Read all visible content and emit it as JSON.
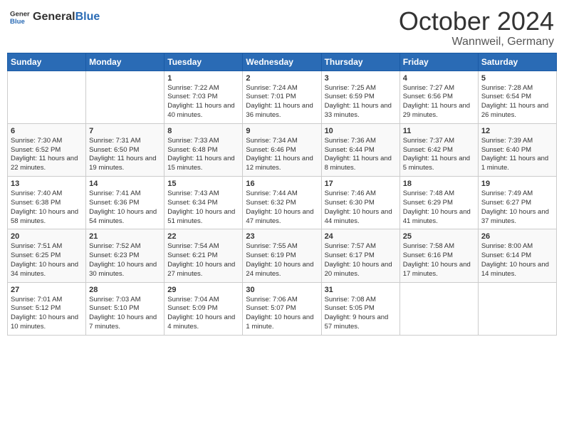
{
  "header": {
    "logo_general": "General",
    "logo_blue": "Blue",
    "month": "October 2024",
    "location": "Wannweil, Germany"
  },
  "weekdays": [
    "Sunday",
    "Monday",
    "Tuesday",
    "Wednesday",
    "Thursday",
    "Friday",
    "Saturday"
  ],
  "weeks": [
    [
      {
        "day": null,
        "sunrise": null,
        "sunset": null,
        "daylight": null
      },
      {
        "day": null,
        "sunrise": null,
        "sunset": null,
        "daylight": null
      },
      {
        "day": "1",
        "sunrise": "Sunrise: 7:22 AM",
        "sunset": "Sunset: 7:03 PM",
        "daylight": "Daylight: 11 hours and 40 minutes."
      },
      {
        "day": "2",
        "sunrise": "Sunrise: 7:24 AM",
        "sunset": "Sunset: 7:01 PM",
        "daylight": "Daylight: 11 hours and 36 minutes."
      },
      {
        "day": "3",
        "sunrise": "Sunrise: 7:25 AM",
        "sunset": "Sunset: 6:59 PM",
        "daylight": "Daylight: 11 hours and 33 minutes."
      },
      {
        "day": "4",
        "sunrise": "Sunrise: 7:27 AM",
        "sunset": "Sunset: 6:56 PM",
        "daylight": "Daylight: 11 hours and 29 minutes."
      },
      {
        "day": "5",
        "sunrise": "Sunrise: 7:28 AM",
        "sunset": "Sunset: 6:54 PM",
        "daylight": "Daylight: 11 hours and 26 minutes."
      }
    ],
    [
      {
        "day": "6",
        "sunrise": "Sunrise: 7:30 AM",
        "sunset": "Sunset: 6:52 PM",
        "daylight": "Daylight: 11 hours and 22 minutes."
      },
      {
        "day": "7",
        "sunrise": "Sunrise: 7:31 AM",
        "sunset": "Sunset: 6:50 PM",
        "daylight": "Daylight: 11 hours and 19 minutes."
      },
      {
        "day": "8",
        "sunrise": "Sunrise: 7:33 AM",
        "sunset": "Sunset: 6:48 PM",
        "daylight": "Daylight: 11 hours and 15 minutes."
      },
      {
        "day": "9",
        "sunrise": "Sunrise: 7:34 AM",
        "sunset": "Sunset: 6:46 PM",
        "daylight": "Daylight: 11 hours and 12 minutes."
      },
      {
        "day": "10",
        "sunrise": "Sunrise: 7:36 AM",
        "sunset": "Sunset: 6:44 PM",
        "daylight": "Daylight: 11 hours and 8 minutes."
      },
      {
        "day": "11",
        "sunrise": "Sunrise: 7:37 AM",
        "sunset": "Sunset: 6:42 PM",
        "daylight": "Daylight: 11 hours and 5 minutes."
      },
      {
        "day": "12",
        "sunrise": "Sunrise: 7:39 AM",
        "sunset": "Sunset: 6:40 PM",
        "daylight": "Daylight: 11 hours and 1 minute."
      }
    ],
    [
      {
        "day": "13",
        "sunrise": "Sunrise: 7:40 AM",
        "sunset": "Sunset: 6:38 PM",
        "daylight": "Daylight: 10 hours and 58 minutes."
      },
      {
        "day": "14",
        "sunrise": "Sunrise: 7:41 AM",
        "sunset": "Sunset: 6:36 PM",
        "daylight": "Daylight: 10 hours and 54 minutes."
      },
      {
        "day": "15",
        "sunrise": "Sunrise: 7:43 AM",
        "sunset": "Sunset: 6:34 PM",
        "daylight": "Daylight: 10 hours and 51 minutes."
      },
      {
        "day": "16",
        "sunrise": "Sunrise: 7:44 AM",
        "sunset": "Sunset: 6:32 PM",
        "daylight": "Daylight: 10 hours and 47 minutes."
      },
      {
        "day": "17",
        "sunrise": "Sunrise: 7:46 AM",
        "sunset": "Sunset: 6:30 PM",
        "daylight": "Daylight: 10 hours and 44 minutes."
      },
      {
        "day": "18",
        "sunrise": "Sunrise: 7:48 AM",
        "sunset": "Sunset: 6:29 PM",
        "daylight": "Daylight: 10 hours and 41 minutes."
      },
      {
        "day": "19",
        "sunrise": "Sunrise: 7:49 AM",
        "sunset": "Sunset: 6:27 PM",
        "daylight": "Daylight: 10 hours and 37 minutes."
      }
    ],
    [
      {
        "day": "20",
        "sunrise": "Sunrise: 7:51 AM",
        "sunset": "Sunset: 6:25 PM",
        "daylight": "Daylight: 10 hours and 34 minutes."
      },
      {
        "day": "21",
        "sunrise": "Sunrise: 7:52 AM",
        "sunset": "Sunset: 6:23 PM",
        "daylight": "Daylight: 10 hours and 30 minutes."
      },
      {
        "day": "22",
        "sunrise": "Sunrise: 7:54 AM",
        "sunset": "Sunset: 6:21 PM",
        "daylight": "Daylight: 10 hours and 27 minutes."
      },
      {
        "day": "23",
        "sunrise": "Sunrise: 7:55 AM",
        "sunset": "Sunset: 6:19 PM",
        "daylight": "Daylight: 10 hours and 24 minutes."
      },
      {
        "day": "24",
        "sunrise": "Sunrise: 7:57 AM",
        "sunset": "Sunset: 6:17 PM",
        "daylight": "Daylight: 10 hours and 20 minutes."
      },
      {
        "day": "25",
        "sunrise": "Sunrise: 7:58 AM",
        "sunset": "Sunset: 6:16 PM",
        "daylight": "Daylight: 10 hours and 17 minutes."
      },
      {
        "day": "26",
        "sunrise": "Sunrise: 8:00 AM",
        "sunset": "Sunset: 6:14 PM",
        "daylight": "Daylight: 10 hours and 14 minutes."
      }
    ],
    [
      {
        "day": "27",
        "sunrise": "Sunrise: 7:01 AM",
        "sunset": "Sunset: 5:12 PM",
        "daylight": "Daylight: 10 hours and 10 minutes."
      },
      {
        "day": "28",
        "sunrise": "Sunrise: 7:03 AM",
        "sunset": "Sunset: 5:10 PM",
        "daylight": "Daylight: 10 hours and 7 minutes."
      },
      {
        "day": "29",
        "sunrise": "Sunrise: 7:04 AM",
        "sunset": "Sunset: 5:09 PM",
        "daylight": "Daylight: 10 hours and 4 minutes."
      },
      {
        "day": "30",
        "sunrise": "Sunrise: 7:06 AM",
        "sunset": "Sunset: 5:07 PM",
        "daylight": "Daylight: 10 hours and 1 minute."
      },
      {
        "day": "31",
        "sunrise": "Sunrise: 7:08 AM",
        "sunset": "Sunset: 5:05 PM",
        "daylight": "Daylight: 9 hours and 57 minutes."
      },
      {
        "day": null,
        "sunrise": null,
        "sunset": null,
        "daylight": null
      },
      {
        "day": null,
        "sunrise": null,
        "sunset": null,
        "daylight": null
      }
    ]
  ]
}
